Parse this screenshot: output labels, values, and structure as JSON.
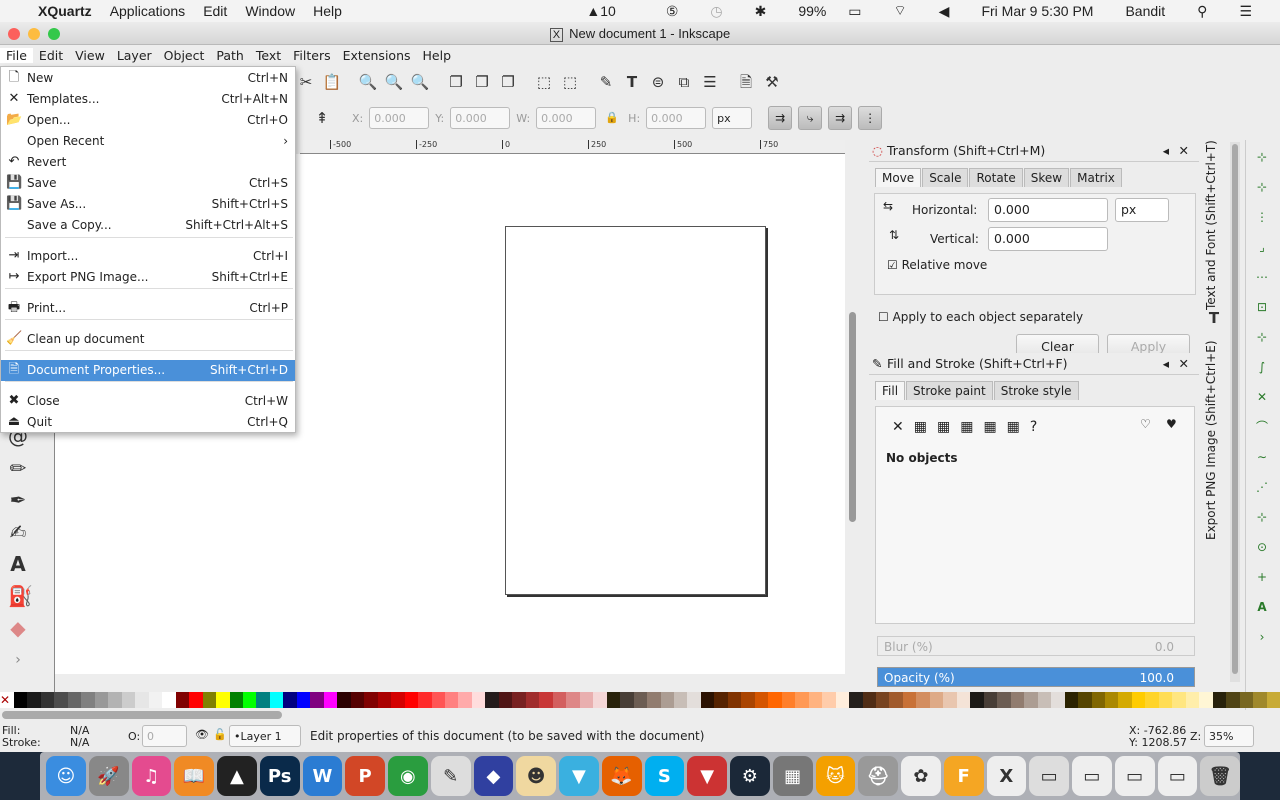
{
  "mac_menubar": {
    "app": "XQuartz",
    "items": [
      "Applications",
      "Edit",
      "Window",
      "Help"
    ],
    "status": {
      "adobe": "10",
      "battery": "99%",
      "datetime": "Fri Mar 9  5:30 PM",
      "user": "Bandit"
    }
  },
  "window": {
    "title": "New document 1 - Inkscape"
  },
  "menubar": [
    "File",
    "Edit",
    "View",
    "Layer",
    "Object",
    "Path",
    "Text",
    "Filters",
    "Extensions",
    "Help"
  ],
  "file_menu": [
    {
      "label": "New",
      "shortcut": "Ctrl+N",
      "icon": "new-document-icon",
      "glyph": "🗋"
    },
    {
      "label": "Templates...",
      "shortcut": "Ctrl+Alt+N",
      "icon": "templates-icon",
      "glyph": "✕"
    },
    {
      "label": "Open...",
      "shortcut": "Ctrl+O",
      "icon": "folder-icon",
      "glyph": "📂"
    },
    {
      "label": "Open Recent",
      "shortcut": "›",
      "icon": "",
      "glyph": ""
    },
    {
      "label": "Revert",
      "shortcut": "",
      "icon": "revert-icon",
      "glyph": "↶"
    },
    {
      "label": "Save",
      "shortcut": "Ctrl+S",
      "icon": "save-icon",
      "glyph": "💾"
    },
    {
      "label": "Save As...",
      "shortcut": "Shift+Ctrl+S",
      "icon": "save-as-icon",
      "glyph": "💾"
    },
    {
      "label": "Save a Copy...",
      "shortcut": "Shift+Ctrl+Alt+S",
      "icon": "",
      "glyph": ""
    },
    {
      "label": "Import...",
      "shortcut": "Ctrl+I",
      "icon": "import-icon",
      "glyph": "⇥"
    },
    {
      "label": "Export PNG Image...",
      "shortcut": "Shift+Ctrl+E",
      "icon": "export-icon",
      "glyph": "↦"
    },
    {
      "label": "Print...",
      "shortcut": "Ctrl+P",
      "icon": "printer-icon",
      "glyph": "🖶"
    },
    {
      "label": "Clean up document",
      "shortcut": "",
      "icon": "vacuum-icon",
      "glyph": "🧹"
    },
    {
      "label": "Document Properties...",
      "shortcut": "Shift+Ctrl+D",
      "icon": "document-properties-icon",
      "glyph": "🗎"
    },
    {
      "label": "Close",
      "shortcut": "Ctrl+W",
      "icon": "close-icon",
      "glyph": "✖"
    },
    {
      "label": "Quit",
      "shortcut": "Ctrl+Q",
      "icon": "quit-icon",
      "glyph": "⏏"
    }
  ],
  "controls": {
    "x_label": "X:",
    "x": "0.000",
    "y_label": "Y:",
    "y": "0.000",
    "w_label": "W:",
    "w": "0.000",
    "h_label": "H:",
    "h": "0.000",
    "unit": "px"
  },
  "ruler": [
    "-500",
    "-250",
    "0",
    "250",
    "500",
    "750"
  ],
  "transform": {
    "title": "Transform (Shift+Ctrl+M)",
    "tabs": [
      "Move",
      "Scale",
      "Rotate",
      "Skew",
      "Matrix"
    ],
    "horizontal_label": "Horizontal:",
    "horizontal": "0.000",
    "vertical_label": "Vertical:",
    "vertical": "0.000",
    "unit": "px",
    "relative_move": "Relative move",
    "apply_each": "Apply to each object separately",
    "clear": "Clear",
    "apply": "Apply"
  },
  "fill_stroke": {
    "title": "Fill and Stroke (Shift+Ctrl+F)",
    "tabs": [
      "Fill",
      "Stroke paint",
      "Stroke style"
    ],
    "no_objects": "No objects",
    "blur_label": "Blur (%)",
    "blur": "0.0",
    "opacity_label": "Opacity (%)",
    "opacity": "100.0"
  },
  "vertical_tabs": [
    "Text and Font (Shift+Ctrl+T)",
    "Export PNG Image (Shift+Ctrl+E)"
  ],
  "status": {
    "fill_label": "Fill:",
    "fill": "N/A",
    "stroke_label": "Stroke:",
    "stroke": "N/A",
    "opacity_label": "O:",
    "opacity": "0",
    "layer": "•Layer 1",
    "message": "Edit properties of this document (to be saved with the document)",
    "x": "X: -762.86",
    "y": "Y: 1208.57",
    "zoom_label": "Z:",
    "zoom": "35%"
  },
  "palette": [
    "#000",
    "#1a1a1a",
    "#333",
    "#4d4d4d",
    "#666",
    "#808080",
    "#999",
    "#b3b3b3",
    "#ccc",
    "#e6e6e6",
    "#f2f2f2",
    "#fff",
    "#800000",
    "#f00",
    "#808000",
    "#ff0",
    "#008000",
    "#0f0",
    "#008080",
    "#0ff",
    "#000080",
    "#00f",
    "#800080",
    "#f0f",
    "#2b0000",
    "#550000",
    "#800000",
    "#aa0000",
    "#d40000",
    "#f00",
    "#ff2a2a",
    "#ff5555",
    "#ff8080",
    "#faa",
    "#fdd",
    "#241c1c",
    "#501616",
    "#782121",
    "#a02c2c",
    "#c83737",
    "#d35f5f",
    "#de8787",
    "#e9afaf",
    "#f4d7d7",
    "#28220b",
    "#483e37",
    "#6c5d53",
    "#917c6f",
    "#ac9d93",
    "#c8beb7",
    "#e3dedb",
    "#2b1100",
    "#552200",
    "#803300",
    "#aa4400",
    "#d45500",
    "#f60",
    "#ff7f2a",
    "#f95",
    "#ffb380",
    "#fca",
    "#fed",
    "#241f1c",
    "#502d16",
    "#784421",
    "#a05a2c",
    "#c87137",
    "#d38d5f",
    "#deaa87",
    "#e9c6af",
    "#f4e3d7",
    "#1c1a17",
    "#483e37",
    "#6c5d53",
    "#917c6f",
    "#ac9d93",
    "#c8beb7",
    "#e3dedb",
    "#2b2200",
    "#554400",
    "#806600",
    "#aa8800",
    "#d4aa00",
    "#fc0",
    "#ffd42a",
    "#fd5",
    "#ffe680",
    "#fea",
    "#fff6d5",
    "#28220b",
    "#504416",
    "#786721",
    "#a0892c",
    "#c8ab37"
  ],
  "dock": [
    {
      "name": "finder",
      "c": "#3a8de0",
      "t": "☺"
    },
    {
      "name": "launchpad",
      "c": "#888",
      "t": "🚀"
    },
    {
      "name": "itunes",
      "c": "#e44b8f",
      "t": "♫"
    },
    {
      "name": "ibooks",
      "c": "#f08a24",
      "t": "📖"
    },
    {
      "name": "inkscape",
      "c": "#222",
      "t": "▲"
    },
    {
      "name": "photoshop",
      "c": "#0a2a4a",
      "t": "Ps"
    },
    {
      "name": "word",
      "c": "#2b7cd3",
      "t": "W"
    },
    {
      "name": "powerpoint",
      "c": "#d24726",
      "t": "P"
    },
    {
      "name": "chrome",
      "c": "#2a9d3f",
      "t": "◉"
    },
    {
      "name": "textedit",
      "c": "#ddd",
      "t": "✎"
    },
    {
      "name": "app-art",
      "c": "#3040a0",
      "t": "◆"
    },
    {
      "name": "app-anime",
      "c": "#f0d8a0",
      "t": "☻"
    },
    {
      "name": "vectorize",
      "c": "#3ab0e0",
      "t": "▼"
    },
    {
      "name": "firefox",
      "c": "#e66000",
      "t": "🦊"
    },
    {
      "name": "skype",
      "c": "#00aff0",
      "t": "S"
    },
    {
      "name": "app-red",
      "c": "#c33",
      "t": "▼"
    },
    {
      "name": "steam",
      "c": "#1b2838",
      "t": "⚙"
    },
    {
      "name": "calculator",
      "c": "#777",
      "t": "▦"
    },
    {
      "name": "scratch",
      "c": "#f4a000",
      "t": "🐱"
    },
    {
      "name": "disk-utility",
      "c": "#999",
      "t": "⛑"
    },
    {
      "name": "photos",
      "c": "#eee",
      "t": "✿"
    },
    {
      "name": "fusion-360",
      "c": "#f5a623",
      "t": "F"
    },
    {
      "name": "xquartz",
      "c": "#eee",
      "t": "X"
    },
    {
      "name": "window-1",
      "c": "#ddd",
      "t": "▭"
    },
    {
      "name": "window-2",
      "c": "#eee",
      "t": "▭"
    },
    {
      "name": "window-3",
      "c": "#eee",
      "t": "▭"
    },
    {
      "name": "window-4",
      "c": "#eee",
      "t": "▭"
    },
    {
      "name": "trash",
      "c": "#ccc",
      "t": "🗑"
    }
  ]
}
